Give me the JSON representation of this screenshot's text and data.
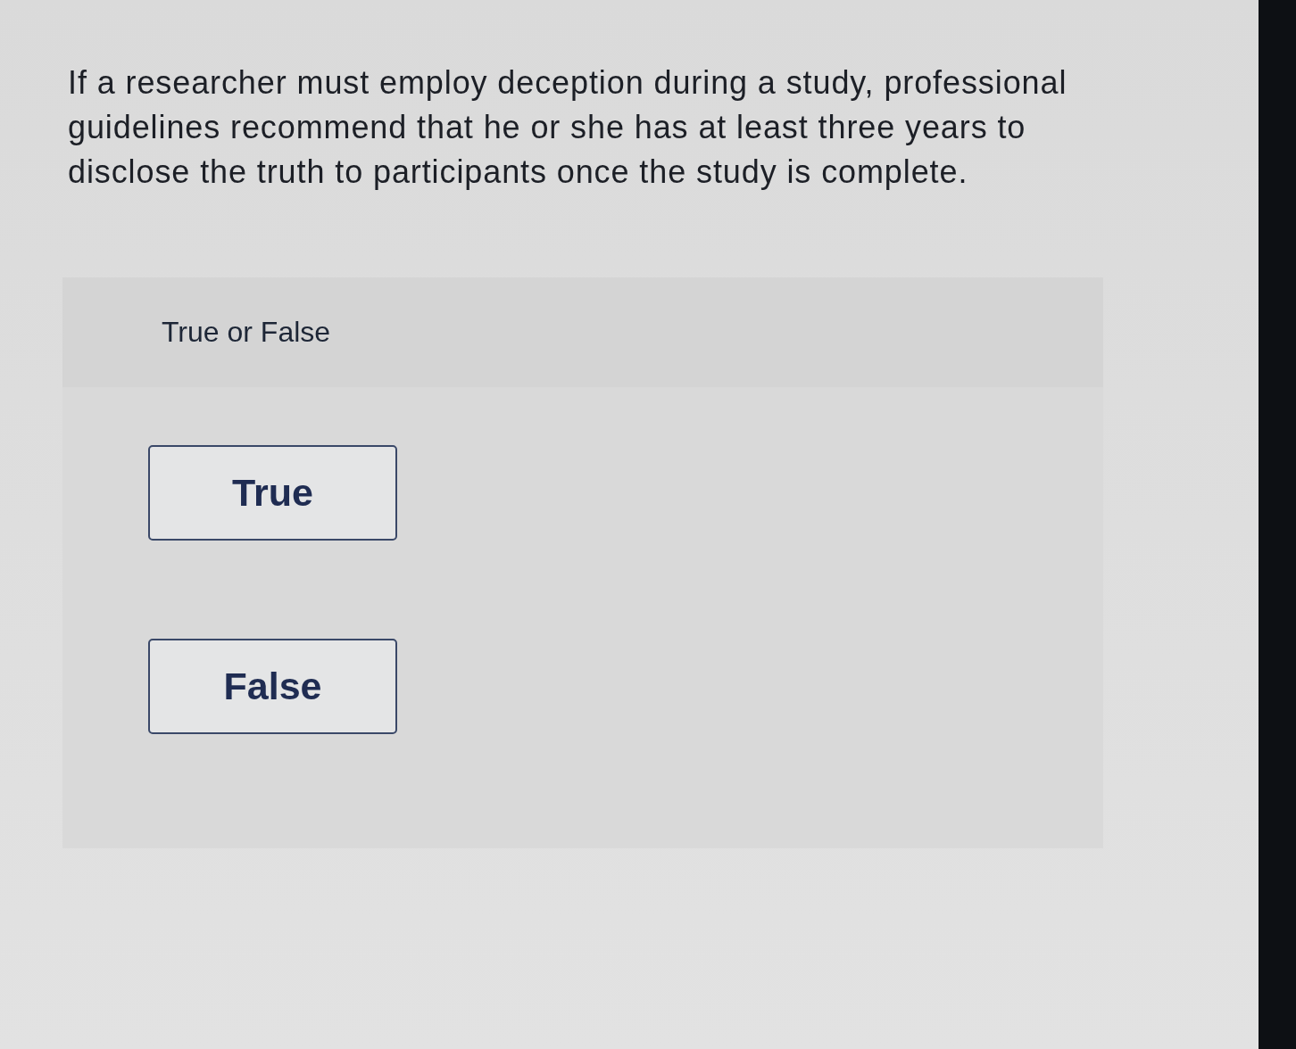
{
  "question": {
    "text": "If a researcher must employ deception during a study, professional guidelines recommend that he or she has at least three years to disclose the truth to participants once the study is complete."
  },
  "answer_panel": {
    "prompt": "True or False",
    "options": [
      {
        "label": "True",
        "selected": false
      },
      {
        "label": "False",
        "selected": false
      }
    ]
  }
}
